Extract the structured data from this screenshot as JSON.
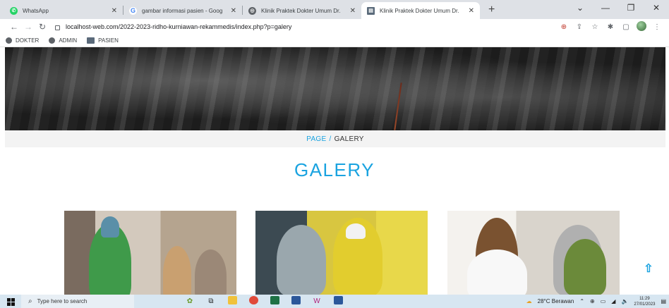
{
  "browser": {
    "tabs": [
      {
        "title": "WhatsApp",
        "favicon_color": "#25d366"
      },
      {
        "title": "gambar informasi pasien - Goog",
        "favicon_color": "#4285f4"
      },
      {
        "title": "Klinik Praktek Dokter Umum Dr.",
        "favicon_color": "#5f6368"
      },
      {
        "title": "Klinik Praktek Dokter Umum Dr.",
        "favicon_color": "#5a6a7a"
      }
    ],
    "new_tab_label": "+",
    "url": "localhost-web.com/2022-2023-ridho-kurniawan-rekammedis/index.php?p=galery",
    "bookmarks": [
      {
        "label": "DOKTER"
      },
      {
        "label": "ADMIN"
      },
      {
        "label": "PASIEN"
      }
    ]
  },
  "page": {
    "breadcrumb": {
      "page_label": "PAGE",
      "separator": "/",
      "current": "GALERY"
    },
    "title": "GALERY"
  },
  "taskbar": {
    "search_placeholder": "Type here to search",
    "weather": "28°C Berawan",
    "time": "11:29",
    "date": "27/01/2023"
  }
}
